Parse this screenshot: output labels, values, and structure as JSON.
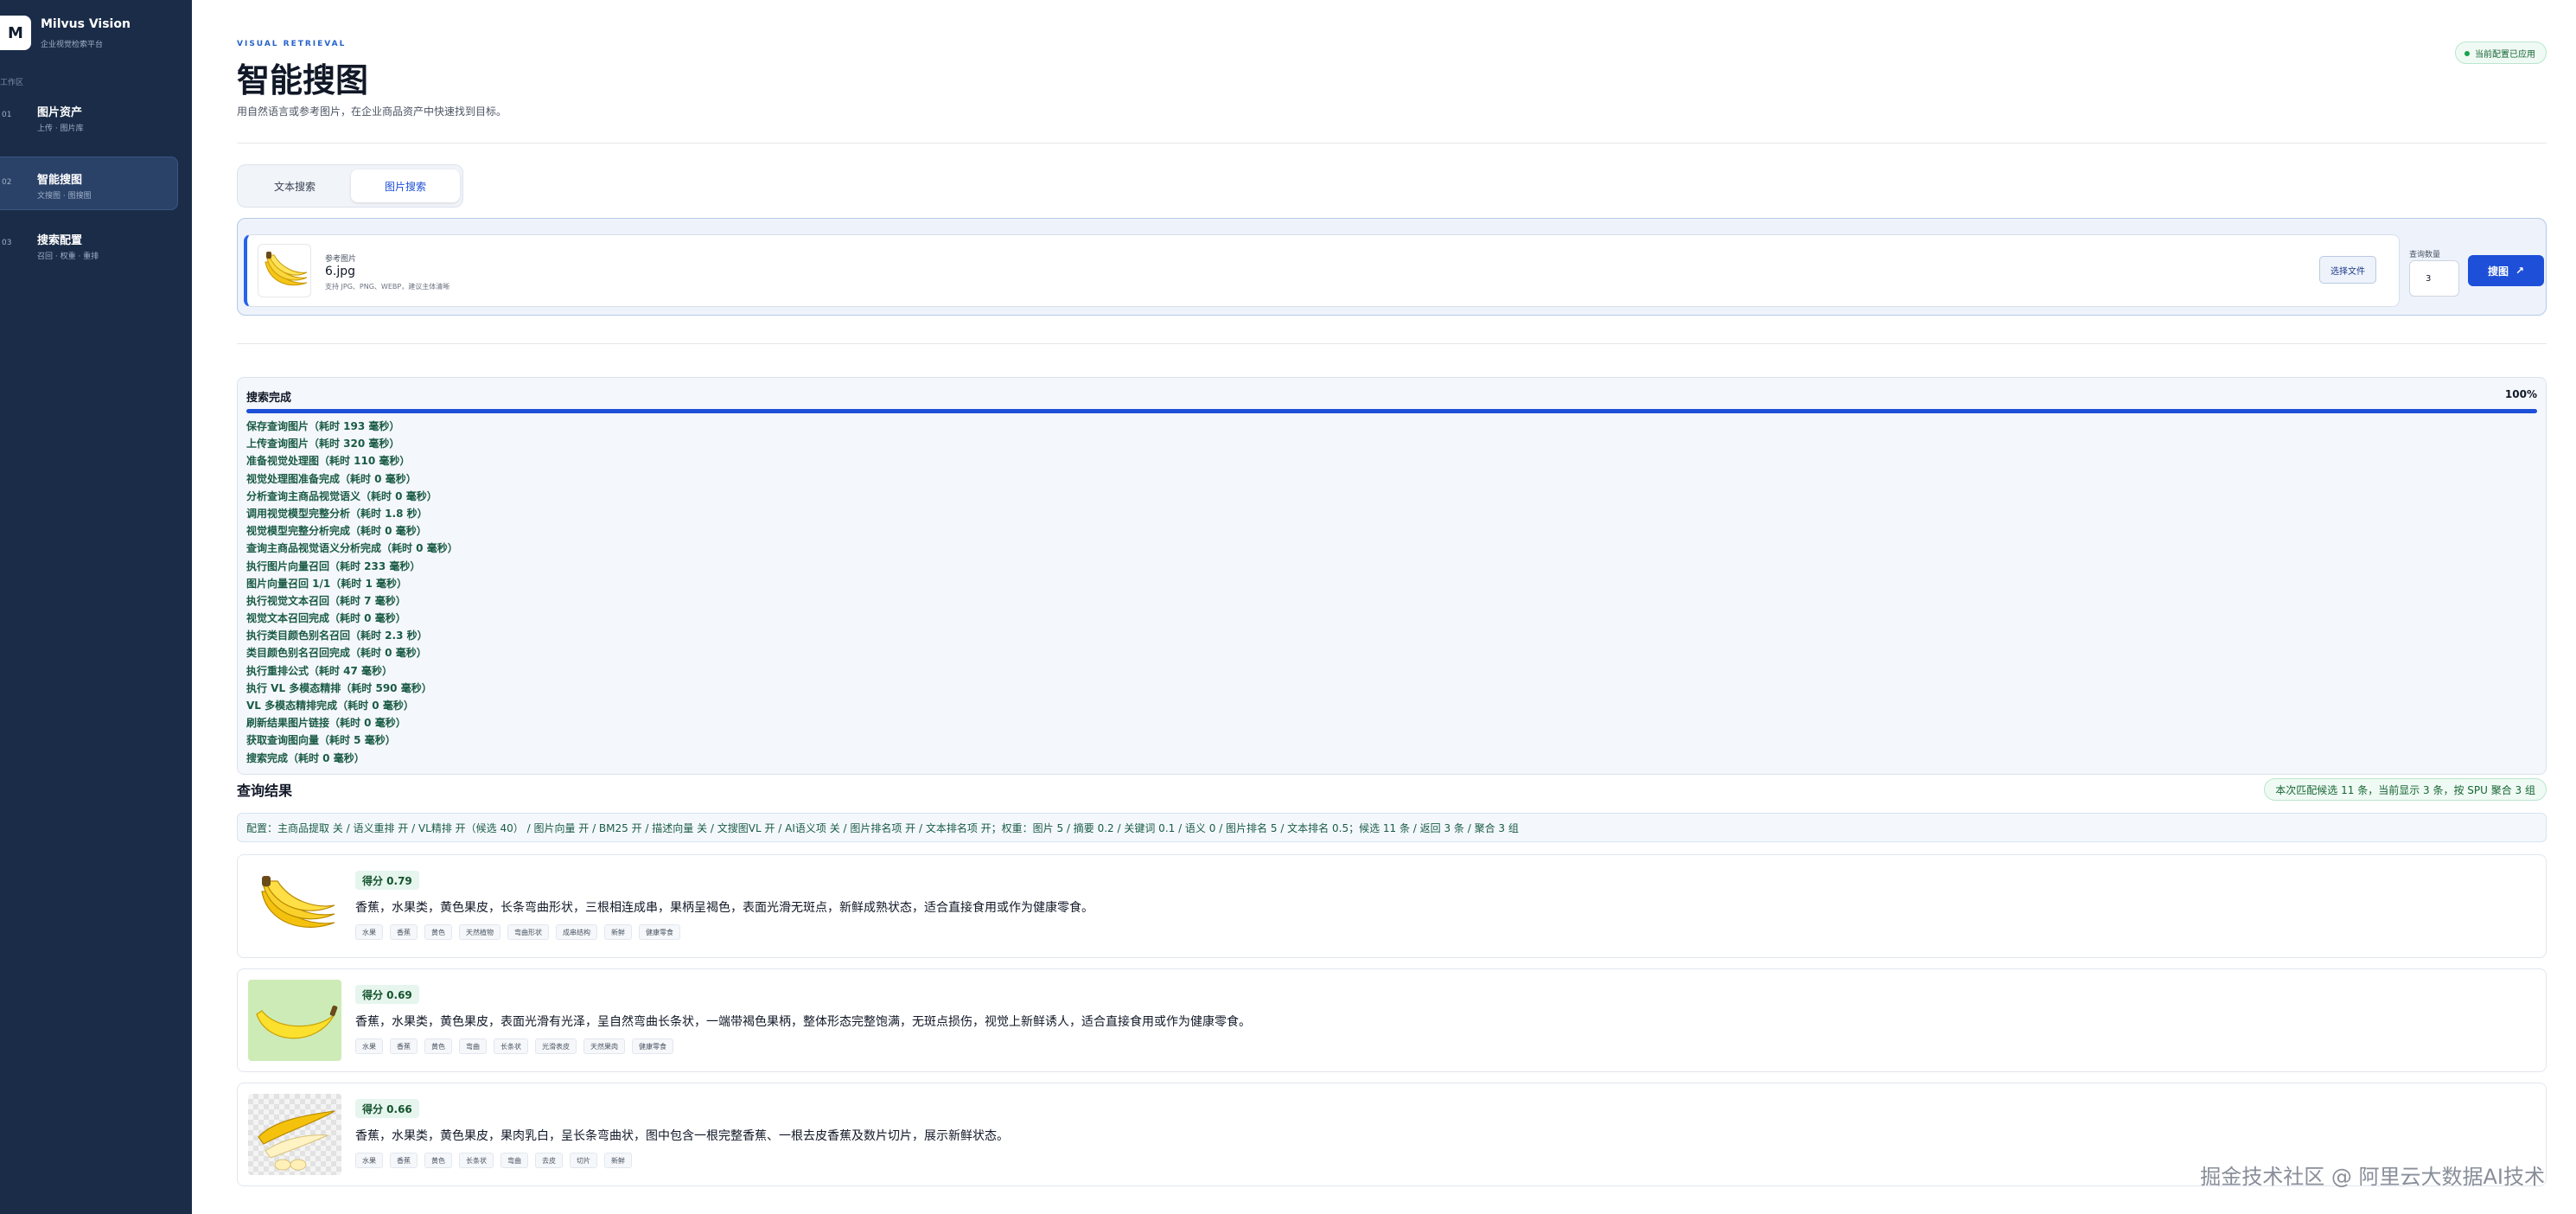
{
  "brand": {
    "logo_letter": "M",
    "title": "Milvus Vision",
    "subtitle": "企业视觉检索平台"
  },
  "sidebar": {
    "section_label": "工作区",
    "items": [
      {
        "num": "01",
        "title": "图片资产",
        "sub": "上传 · 图片库"
      },
      {
        "num": "02",
        "title": "智能搜图",
        "sub": "文搜图 · 图搜图"
      },
      {
        "num": "03",
        "title": "搜索配置",
        "sub": "召回 · 权重 · 重排"
      }
    ]
  },
  "header": {
    "eyebrow": "VISUAL RETRIEVAL",
    "title": "智能搜图",
    "description": "用自然语言或参考图片，在企业商品资产中快速找到目标。",
    "status": "当前配置已应用"
  },
  "tabs": [
    {
      "label": "文本搜索"
    },
    {
      "label": "图片搜索"
    }
  ],
  "upload": {
    "ref_label": "参考图片",
    "file_name": "6.jpg",
    "hint": "支持 JPG、PNG、WEBP，建议主体清晰",
    "choose_label": "选择文件",
    "qty_label": "查询数量",
    "qty_value": "3",
    "search_label": "搜图",
    "search_icon": "↗"
  },
  "progress": {
    "title": "搜索完成",
    "percent_label": "100%",
    "percent": 100,
    "steps": [
      "保存查询图片（耗时 193 毫秒）",
      "上传查询图片（耗时 320 毫秒）",
      "准备视觉处理图（耗时 110 毫秒）",
      "视觉处理图准备完成（耗时 0 毫秒）",
      "分析查询主商品视觉语义（耗时 0 毫秒）",
      "调用视觉模型完整分析（耗时 1.8 秒）",
      "视觉模型完整分析完成（耗时 0 毫秒）",
      "查询主商品视觉语义分析完成（耗时 0 毫秒）",
      "执行图片向量召回（耗时 233 毫秒）",
      "图片向量召回 1/1（耗时 1 毫秒）",
      "执行视觉文本召回（耗时 7 毫秒）",
      "视觉文本召回完成（耗时 0 毫秒）",
      "执行类目颜色别名召回（耗时 2.3 秒）",
      "类目颜色别名召回完成（耗时 0 毫秒）",
      "执行重排公式（耗时 47 毫秒）",
      "执行 VL 多模态精排（耗时 590 毫秒）",
      "VL 多模态精排完成（耗时 0 毫秒）",
      "刷新结果图片链接（耗时 0 毫秒）",
      "获取查询图向量（耗时 5 毫秒）",
      "搜索完成（耗时 0 毫秒）"
    ]
  },
  "results": {
    "title": "查询结果",
    "summary": "本次匹配候选 11 条，当前显示 3 条，按 SPU 聚合 3 组",
    "config": "配置：主商品提取 关 / 语义重排 开 / VL精排 开（候选 40） / 图片向量 开 / BM25 开 / 描述向量 关 / 文搜图VL 开 / AI语义项 关 / 图片排名项 开 / 文本排名项 开；权重：图片 5 / 摘要 0.2 / 关键词 0.1 / 语义 0 / 图片排名 5 / 文本排名 0.5；候选 11 条 / 返回 3 条 / 聚合 3 组",
    "items": [
      {
        "score": "得分 0.79",
        "description": "香蕉，水果类，黄色果皮，长条弯曲形状，三根相连成串，果柄呈褐色，表面光滑无斑点，新鲜成熟状态，适合直接食用或作为健康零食。",
        "tags": [
          "水果",
          "香蕉",
          "黄色",
          "天然植物",
          "弯曲形状",
          "成串结构",
          "新鲜",
          "健康零食"
        ]
      },
      {
        "score": "得分 0.69",
        "description": "香蕉，水果类，黄色果皮，表面光滑有光泽，呈自然弯曲长条状，一端带褐色果柄，整体形态完整饱满，无斑点损伤，视觉上新鲜诱人，适合直接食用或作为健康零食。",
        "tags": [
          "水果",
          "香蕉",
          "黄色",
          "弯曲",
          "长条状",
          "光滑表皮",
          "天然果肉",
          "健康零食"
        ]
      },
      {
        "score": "得分 0.66",
        "description": "香蕉，水果类，黄色果皮，果肉乳白，呈长条弯曲状，图中包含一根完整香蕉、一根去皮香蕉及数片切片，展示新鲜状态。",
        "tags": [
          "水果",
          "香蕉",
          "黄色",
          "长条状",
          "弯曲",
          "去皮",
          "切片",
          "新鲜"
        ]
      }
    ]
  },
  "watermark": "掘金技术社区 @ 阿里云大数据AI技术",
  "colors": {
    "sidebar": "#1a2c47",
    "accent": "#1d4fd8",
    "success": "#166534"
  }
}
